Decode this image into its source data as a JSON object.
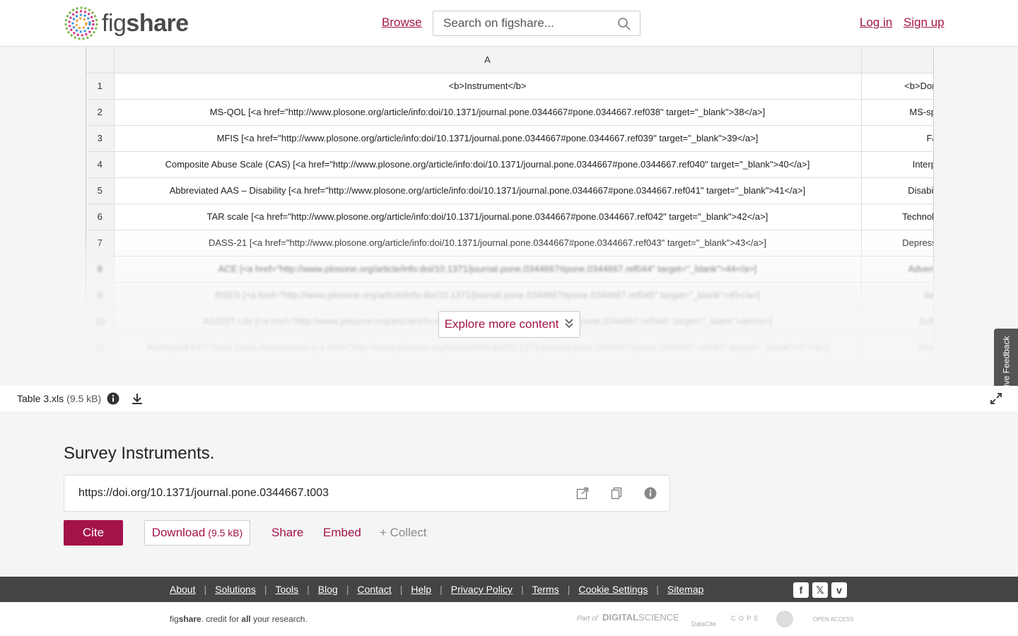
{
  "header": {
    "logo_text_fig": "fig",
    "logo_text_share": "share",
    "browse_label": "Browse",
    "search_placeholder": "Search on figshare...",
    "login_label": "Log in",
    "signup_label": "Sign up"
  },
  "spreadsheet": {
    "column_headers": [
      "A"
    ],
    "rows": [
      {
        "num": "1",
        "a": "<b>Instrument</b>",
        "b": "<b>Domain ..."
      },
      {
        "num": "2",
        "a": "MS-QOL [<a href=\"http://www.plosone.org/article/info:doi/10.1371/journal.pone.0344667#pone.0344667.ref038\" target=\"_blank\">38</a>]",
        "b": "MS-specific"
      },
      {
        "num": "3",
        "a": "MFIS [<a href=\"http://www.plosone.org/article/info:doi/10.1371/journal.pone.0344667#pone.0344667.ref039\" target=\"_blank\">39</a>]",
        "b": "Fat"
      },
      {
        "num": "4",
        "a": "Composite Abuse Scale (CAS) [<a href=\"http://www.plosone.org/article/info:doi/10.1371/journal.pone.0344667#pone.0344667.ref040\" target=\"_blank\">40</a>]",
        "b": "Interperso"
      },
      {
        "num": "5",
        "a": "Abbreviated AAS – Disability [<a href=\"http://www.plosone.org/article/info:doi/10.1371/journal.pone.0344667#pone.0344667.ref041\" target=\"_blank\">41</a>]",
        "b": "Disability-tar"
      },
      {
        "num": "6",
        "a": "TAR scale [<a href=\"http://www.plosone.org/article/info:doi/10.1371/journal.pone.0344667#pone.0344667.ref042\" target=\"_blank\">42</a>]",
        "b": "Technology-fac"
      },
      {
        "num": "7",
        "a": "DASS-21 [<a href=\"http://www.plosone.org/article/info:doi/10.1371/journal.pone.0344667#pone.0344667.ref043\" target=\"_blank\">43</a>]",
        "b": "Depression, an"
      },
      {
        "num": "8",
        "a": "ACE [<a href=\"http://www.plosone.org/article/info:doi/10.1371/journal.pone.0344667#pone.0344667.ref044\" target=\"_blank\">44</a>]",
        "b": "Adverse Chi"
      },
      {
        "num": "9",
        "a": "RSES [<a href=\"http://www.plosone.org/article/info:doi/10.1371/journal.pone.0344667#pone.0344667.ref045\" target=\"_blank\">45</a>]",
        "b": "Self-"
      },
      {
        "num": "10",
        "a": "ASSIST-Lite [<a href=\"http://www.plosone.org/article/info:doi/10.1371/journal.pone.0344667#pone.0344667.ref046\" target=\"_blank\">46</a>]",
        "b": "Substa"
      },
      {
        "num": "11",
        "a": "Attempted PVT Trust Scale Assessment [<a href=\"http://www.plosone.org/article/info:doi/10.1371/journal.pone.0344667#pone.0344667.ref047\" target=\"_blank\">47</a>]",
        "b": "Trust in"
      }
    ]
  },
  "explore_label": "Explore more content",
  "feedback_label": "Give Feedback",
  "file": {
    "name": "Table 3.xls",
    "size": "(9.5 kB)"
  },
  "item": {
    "title": "Survey Instruments.",
    "doi": "https://doi.org/10.1371/journal.pone.0344667.t003"
  },
  "actions": {
    "cite": "Cite",
    "download": "Download",
    "download_size": "(9.5 kB)",
    "share": "Share",
    "embed": "Embed",
    "collect": "+ Collect"
  },
  "footer": {
    "links": [
      "About",
      "Solutions",
      "Tools",
      "Blog",
      "Contact",
      "Help",
      "Privacy Policy",
      "Terms",
      "Cookie Settings",
      "Sitemap"
    ],
    "tagline_fig": "fig",
    "tagline_share": "share",
    "tagline_mid": ". credit for ",
    "tagline_all": "all",
    "tagline_end": " your research.",
    "partners": {
      "part_of": "Part of",
      "digital": "DIGITAL",
      "science": "SCIENCE",
      "datacite": "DataCite",
      "cope": "C O P E",
      "open_access": "OPEN ACCESS"
    }
  },
  "colors": {
    "brand": "#a3134a",
    "footer_bg": "#444444",
    "page_bg": "#f5f5f5"
  }
}
